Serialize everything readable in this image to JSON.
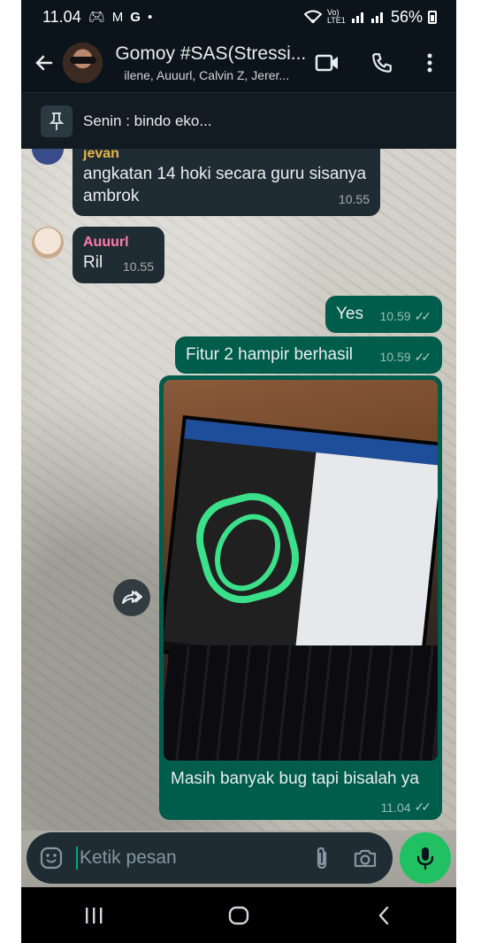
{
  "status_bar": {
    "time": "11.04",
    "battery": "56%",
    "carrier_label": "Vo) LTE1"
  },
  "header": {
    "title": "Gomoy #SAS(Stressi...",
    "subtitle": "ilene, Auuurl, Calvin Z, Jerer..."
  },
  "pinned": {
    "text": "Senin : bindo eko..."
  },
  "messages": [
    {
      "sender": "jevan",
      "text": "angkatan 14 hoki secara guru sisanya ambrok",
      "time": "10.55",
      "direction": "in",
      "sender_color": "#e6b64c"
    },
    {
      "sender": "Auuurl",
      "text": "Ril",
      "time": "10.55",
      "direction": "in",
      "sender_color": "#ff7aa8"
    },
    {
      "text": "Yes",
      "time": "10.59",
      "direction": "out",
      "status": "read"
    },
    {
      "text": "Fitur 2 hampir berhasil",
      "time": "10.59",
      "direction": "out",
      "status": "read"
    },
    {
      "type": "image",
      "caption": "Masih banyak bug tapi bisalah ya",
      "time": "11.04",
      "direction": "out",
      "status": "read"
    }
  ],
  "input": {
    "placeholder": "Ketik pesan"
  },
  "icons": {
    "back": "arrow-left-icon",
    "video": "video-call-icon",
    "call": "phone-icon",
    "menu": "more-vert-icon",
    "pin": "pin-icon",
    "forward": "forward-icon",
    "emoji": "emoji-icon",
    "attach": "paperclip-icon",
    "camera": "camera-icon",
    "mic": "mic-icon"
  },
  "colors": {
    "incoming_bubble": "#202c33",
    "outgoing_bubble": "#005c4b",
    "accent": "#21c063"
  }
}
